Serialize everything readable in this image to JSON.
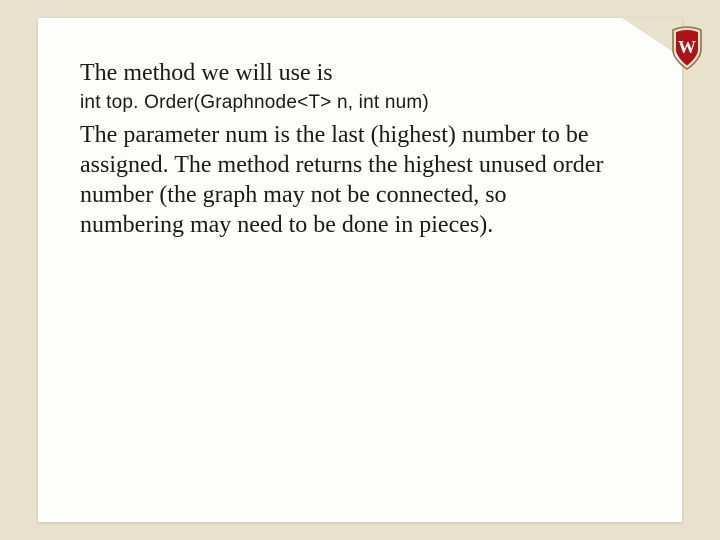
{
  "content": {
    "para1": "The method we will use is",
    "code": "int top. Order(Graphnode<T> n, int num)",
    "para2": "The parameter num is the last (highest) number to be assigned. The method returns the highest unused order number (the graph may not be connected, so numbering may need to be done in pieces)."
  }
}
